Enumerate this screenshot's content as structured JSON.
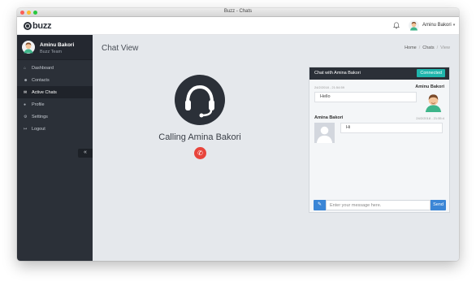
{
  "window": {
    "title": "Buzz - Chats"
  },
  "topbar": {
    "logo_text": "buzz",
    "bell_icon": "bell-icon",
    "user_name": "Aminu Bakori",
    "caret": "▾"
  },
  "sidebar": {
    "profile": {
      "name": "Aminu Bakori",
      "team": "Buzz Team"
    },
    "items": [
      {
        "label": "Dashboard",
        "icon": "home-icon",
        "glyph": "⌂",
        "active": false
      },
      {
        "label": "Contacts",
        "icon": "users-icon",
        "glyph": "☻",
        "active": false
      },
      {
        "label": "Active Chats",
        "icon": "chat-icon",
        "glyph": "✉",
        "active": true
      },
      {
        "label": "Profile",
        "icon": "user-icon",
        "glyph": "●",
        "active": false
      },
      {
        "label": "Settings",
        "icon": "gear-icon",
        "glyph": "⚙",
        "active": false
      },
      {
        "label": "Logout",
        "icon": "logout-icon",
        "glyph": "↦",
        "active": false
      }
    ],
    "collapse_glyph": "«"
  },
  "main": {
    "title": "Chat View",
    "breadcrumb": [
      "Home",
      "Chats",
      "View"
    ],
    "call": {
      "text": "Calling Amina Bakori",
      "icon": "headset-icon",
      "hangup_icon": "phone-hangup-icon",
      "hangup_glyph": "✆"
    }
  },
  "chat": {
    "title": "Chat with Amina Bakori",
    "status": "Connected",
    "status_color": "#1fb5ac",
    "messages": [
      {
        "name": "Aminu Bakori",
        "time": "24/2/2018 - 21:54:59",
        "text": "Hello",
        "side": "right"
      },
      {
        "name": "Amina Bakori",
        "time": "24/2/2018 - 21:55:4",
        "text": "Hi",
        "side": "left"
      }
    ],
    "input_placeholder": "Enter your message here.",
    "attach_icon": "attach-icon",
    "attach_glyph": "✎",
    "send_label": "Send"
  },
  "colors": {
    "sidebar_bg": "#2b3038",
    "accent_blue": "#3b86d6",
    "hangup_red": "#e8453c"
  }
}
